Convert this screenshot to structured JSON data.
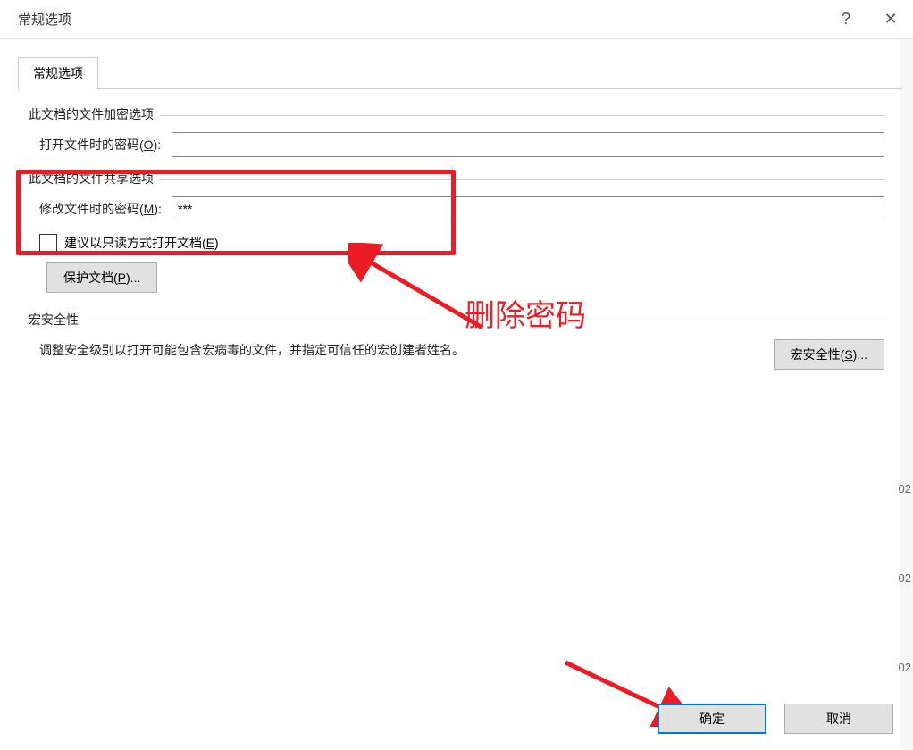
{
  "titlebar": {
    "title": "常规选项",
    "help": "?",
    "close": "✕"
  },
  "tab": {
    "label": "常规选项"
  },
  "encrypt": {
    "section": "此文档的文件加密选项",
    "open_pw_label_pre": "打开文件时的密码(",
    "open_pw_key": "O",
    "open_pw_label_post": "):",
    "open_pw_value": ""
  },
  "share": {
    "section": "此文档的文件共享选项",
    "mod_pw_label_pre": "修改文件时的密码(",
    "mod_pw_key": "M",
    "mod_pw_label_post": "):",
    "mod_pw_value": "***"
  },
  "readonly": {
    "label_pre": "建议以只读方式打开文档(",
    "key": "E",
    "label_post": ")"
  },
  "protect_btn": {
    "label_pre": "保护文档(",
    "key": "P",
    "label_post": ")..."
  },
  "macro": {
    "section": "宏安全性",
    "text": "调整安全级别以打开可能包含宏病毒的文件，并指定可信任的宏创建者姓名。",
    "btn_pre": "宏安全性(",
    "btn_key": "S",
    "btn_post": ")..."
  },
  "buttons": {
    "ok": "确定",
    "cancel": "取消"
  },
  "annotation": {
    "text": "删除密码"
  },
  "bg": {
    "t1": "02",
    "t2": "02",
    "t3": "02"
  }
}
